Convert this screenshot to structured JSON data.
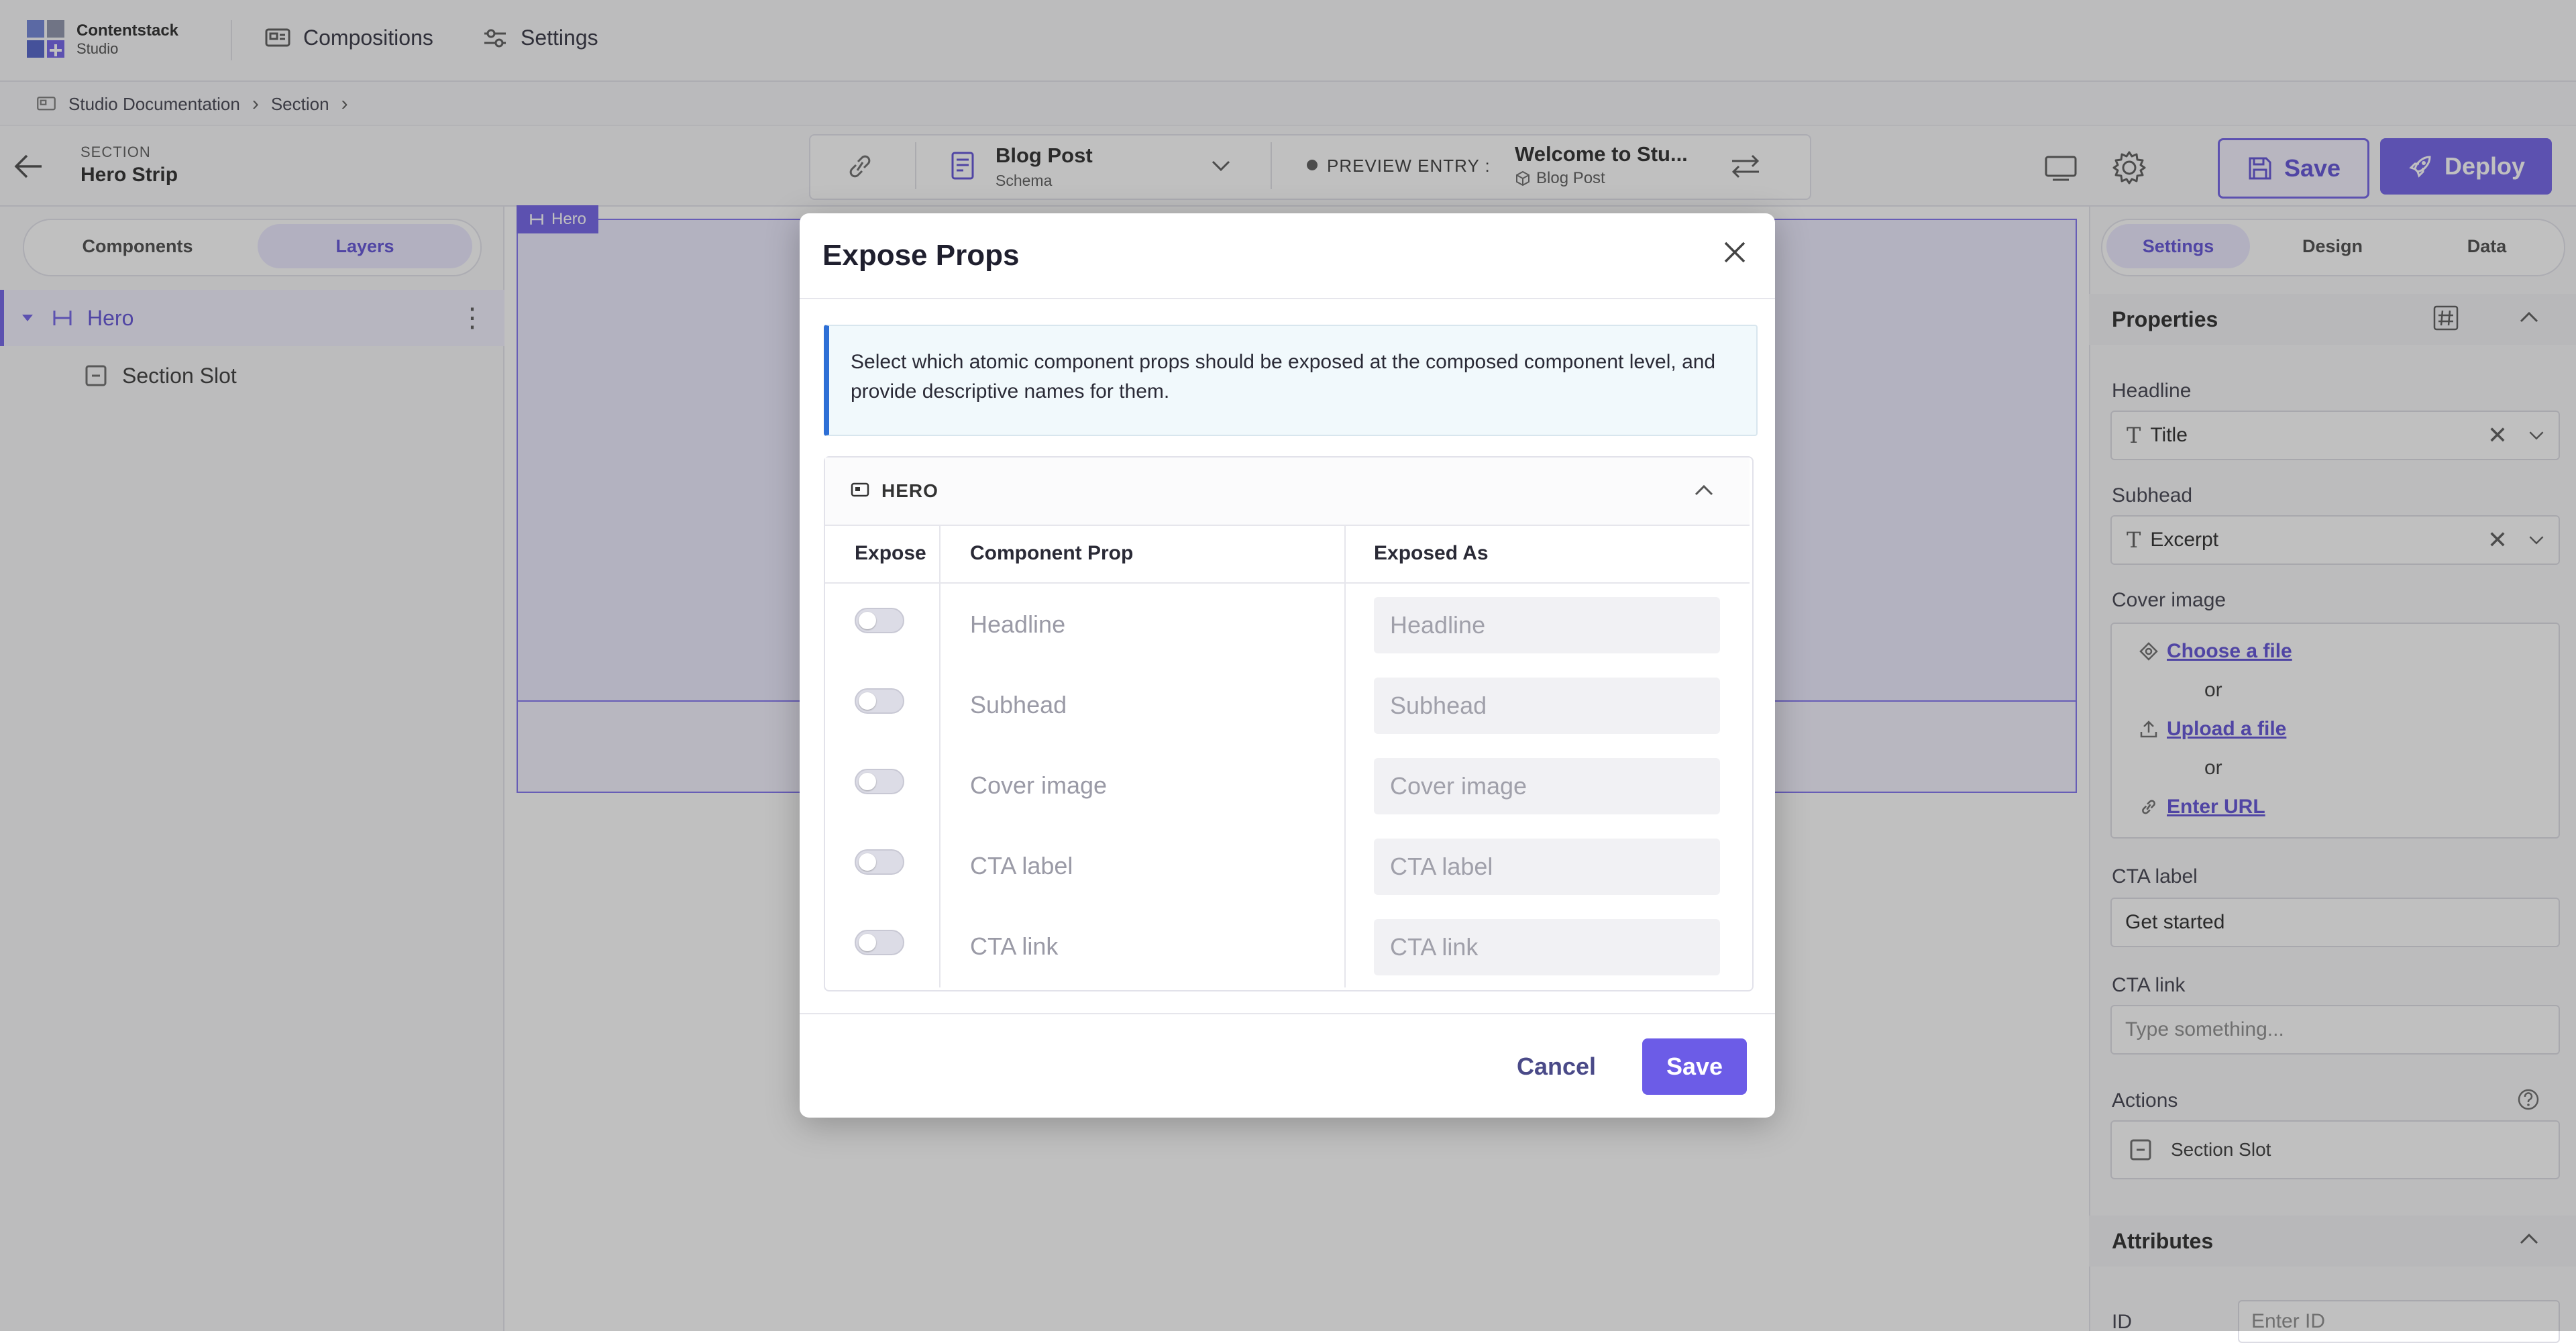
{
  "brand": {
    "name": "Contentstack",
    "product": "Studio"
  },
  "nav": {
    "compositions": "Compositions",
    "settings": "Settings"
  },
  "breadcrumb": {
    "items": [
      "Studio Documentation",
      "Section"
    ]
  },
  "section": {
    "kicker": "SECTION",
    "title": "Hero Strip"
  },
  "schema": {
    "title": "Blog Post",
    "subtitle": "Schema"
  },
  "preview": {
    "label": "PREVIEW ENTRY :",
    "entry_title": "Welcome to Stu...",
    "entry_type": "Blog Post"
  },
  "actions": {
    "save": "Save",
    "deploy": "Deploy"
  },
  "left_tabs": {
    "components": "Components",
    "layers": "Layers"
  },
  "layers": {
    "hero": "Hero",
    "slot": "Section Slot"
  },
  "canvas": {
    "hero_tag": "Hero"
  },
  "right_tabs": {
    "settings": "Settings",
    "design": "Design",
    "data": "Data"
  },
  "properties": {
    "heading": "Properties",
    "headline_label": "Headline",
    "headline_value": "Title",
    "subhead_label": "Subhead",
    "subhead_value": "Excerpt",
    "cover_label": "Cover image",
    "choose_file": "Choose a file",
    "or1": "or",
    "upload_file": "Upload a file",
    "or2": "or",
    "enter_url": "Enter URL",
    "cta_label_label": "CTA label",
    "cta_label_value": "Get started",
    "cta_link_label": "CTA link",
    "cta_link_placeholder": "Type something...",
    "actions_label": "Actions",
    "actions_slot": "Section Slot",
    "attributes_heading": "Attributes",
    "id_label": "ID",
    "id_placeholder": "Enter ID"
  },
  "modal": {
    "title": "Expose Props",
    "info": "Select which atomic component props should be exposed at the composed component level, and provide descriptive names for them.",
    "group": "HERO",
    "columns": {
      "expose": "Expose",
      "prop": "Component Prop",
      "exposed_as": "Exposed As"
    },
    "rows": [
      {
        "prop": "Headline",
        "placeholder": "Headline",
        "enabled": false
      },
      {
        "prop": "Subhead",
        "placeholder": "Subhead",
        "enabled": false
      },
      {
        "prop": "Cover image",
        "placeholder": "Cover image",
        "enabled": false
      },
      {
        "prop": "CTA label",
        "placeholder": "CTA label",
        "enabled": false
      },
      {
        "prop": "CTA link",
        "placeholder": "CTA link",
        "enabled": false
      }
    ],
    "cancel": "Cancel",
    "save": "Save"
  },
  "colors": {
    "accent": "#6c5ce7",
    "info_border": "#2d6fd6"
  }
}
